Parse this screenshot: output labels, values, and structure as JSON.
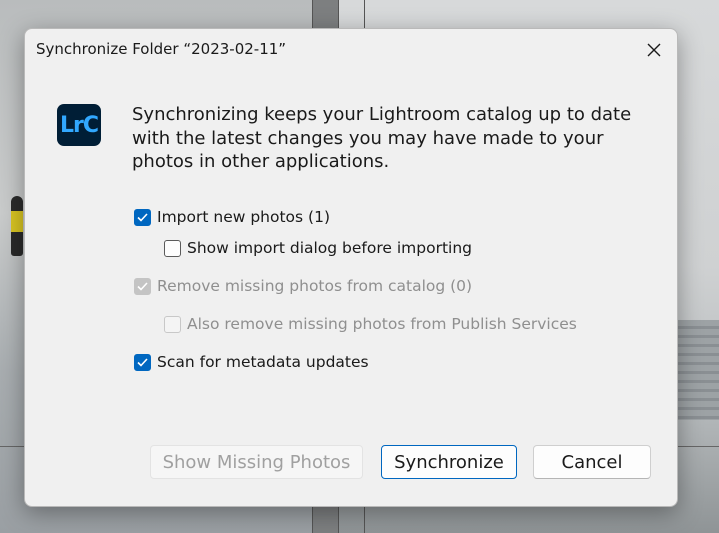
{
  "dialog": {
    "title": "Synchronize Folder “2023-02-11”",
    "app_icon_text": "LrC",
    "description": "Synchronizing keeps your Lightroom catalog up to date with the latest changes you may have made to your photos in other applications."
  },
  "options": {
    "import_new": {
      "label": "Import new photos (1)",
      "checked": true,
      "enabled": true
    },
    "show_import_dialog": {
      "label": "Show import dialog before importing",
      "checked": false,
      "enabled": true
    },
    "remove_missing": {
      "label": "Remove missing photos from catalog (0)",
      "checked": true,
      "enabled": false
    },
    "also_remove_publish": {
      "label": "Also remove missing photos from Publish Services",
      "checked": false,
      "enabled": false
    },
    "scan_metadata": {
      "label": "Scan for metadata updates",
      "checked": true,
      "enabled": true
    }
  },
  "buttons": {
    "show_missing": "Show Missing Photos",
    "synchronize": "Synchronize",
    "cancel": "Cancel"
  },
  "colors": {
    "accent": "#0067c0",
    "dialog_bg": "#f0f0f0",
    "app_icon_bg": "#001e36",
    "app_icon_fg": "#31a8ff"
  },
  "icons": {
    "close": "close-icon",
    "check": "checkmark-icon",
    "app": "lightroom-classic-icon"
  }
}
